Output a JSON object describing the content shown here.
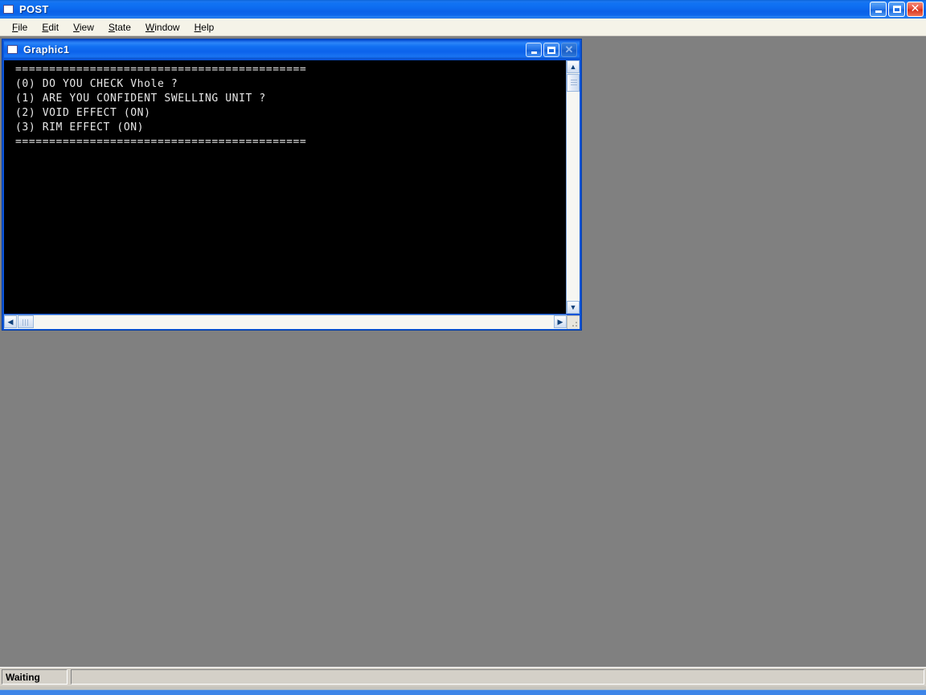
{
  "app": {
    "title": "POST",
    "icon": "window-icon",
    "titlebar_color": "#0d6cf0",
    "buttons": [
      {
        "name": "minimize",
        "glyph": "_"
      },
      {
        "name": "maximize",
        "glyph": "❐"
      },
      {
        "name": "close",
        "glyph": "✕"
      }
    ]
  },
  "menubar": {
    "items": [
      {
        "label": "File",
        "accelerator": "F"
      },
      {
        "label": "Edit",
        "accelerator": "E"
      },
      {
        "label": "View",
        "accelerator": "V"
      },
      {
        "label": "State",
        "accelerator": "S"
      },
      {
        "label": "Window",
        "accelerator": "W"
      },
      {
        "label": "Help",
        "accelerator": "H"
      }
    ]
  },
  "child_window": {
    "title": "Graphic1",
    "icon": "window-icon",
    "buttons": [
      {
        "name": "minimize",
        "glyph": "_"
      },
      {
        "name": "maximize",
        "glyph": "❐"
      },
      {
        "name": "close",
        "glyph": "✕"
      }
    ],
    "terminal": {
      "background_color": "#000000",
      "text_color": "#e8e8e8",
      "lines": [
        "===========================================",
        "(0) DO YOU CHECK Vhole ?",
        "(1) ARE YOU CONFIDENT SWELLING UNIT ?",
        "(2) VOID EFFECT (ON)",
        "(3) RIM EFFECT (ON)",
        "==========================================="
      ]
    },
    "vertical_scrollbar": {
      "up_arrow": "▲",
      "down_arrow": "▼"
    },
    "horizontal_scrollbar": {
      "left_arrow": "◀",
      "right_arrow": "▶"
    }
  },
  "statusbar": {
    "panels": [
      {
        "label": "Waiting"
      },
      {
        "label": ""
      }
    ]
  },
  "desktop": {
    "mdi_background_color": "#808080"
  }
}
